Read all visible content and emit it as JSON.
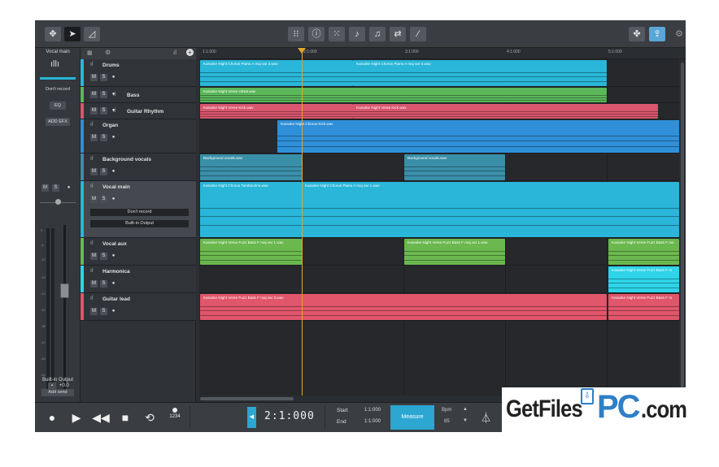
{
  "toolbar": {
    "left_icons": [
      "move-icon",
      "pointer-icon",
      "ramp-icon"
    ],
    "center_icons": [
      "grid-icon",
      "info-icon",
      "random-icon",
      "tuner-icon",
      "score-icon",
      "loop-icon",
      "wand-icon"
    ],
    "right_icons": [
      "settings-knob-icon",
      "share-icon",
      "gear-icon"
    ]
  },
  "inspector": {
    "title": "Vocal main",
    "record_mode": "Don't record",
    "eq_label": "EQ",
    "add_fx_label": "ADD EFX",
    "mute": "M",
    "solo": "S",
    "volume_value": "+0.0",
    "output": "Built-in Output",
    "add_send": "Add send",
    "meter_scale": [
      "0",
      "-6",
      "-12",
      "-18",
      "-24",
      "-30",
      "-36",
      "-42",
      "-48",
      "-54",
      "-60"
    ]
  },
  "header_controls": {
    "grid_icon": "track-grid-icon",
    "gear_icon": "gear-icon",
    "add_icon": "add-track-icon"
  },
  "tracks": [
    {
      "name": "Drums",
      "color": "#29b6d8",
      "m": "M",
      "s": "S"
    },
    {
      "name": "Bass",
      "color": "#5ab85a",
      "m": "M",
      "s": "S"
    },
    {
      "name": "Guitar Rhythm",
      "color": "#d9566e",
      "m": "M",
      "s": "S"
    },
    {
      "name": "Organ",
      "color": "#2f8fd8",
      "m": "M",
      "s": "S"
    },
    {
      "name": "Background vocals",
      "color": "#3a8fa8",
      "m": "M",
      "s": "S"
    },
    {
      "name": "Vocal main",
      "color": "#29b6d8",
      "m": "M",
      "s": "S",
      "record": "Don't record",
      "output": "Built-in Output"
    },
    {
      "name": "Vocal aux",
      "color": "#6ab84e",
      "m": "M",
      "s": "S"
    },
    {
      "name": "Harmonica",
      "color": "#2fd4e8",
      "m": "M",
      "s": "S"
    },
    {
      "name": "Guitar lead",
      "color": "#e0566a",
      "m": "M",
      "s": "S"
    }
  ],
  "ruler": [
    "1:1:000",
    "2:1:000",
    "3:1:000",
    "4:1:000",
    "5:1:000"
  ],
  "clips": {
    "drums": [
      "Karaoke Night Chorus Piano A maj var 3.wav",
      "Karaoke Night Chorus Piano A maj var 3.wav"
    ],
    "bass": [
      "Karaoke Night Verse HiHat.wav"
    ],
    "guitar_rhythm": [
      "Karaoke Night Verse Kick.wav",
      "Karaoke Night Verse Kick.wav"
    ],
    "organ": [
      "Karaoke Night Chorus Kick.wav"
    ],
    "background_vocals": [
      "Background vocals.wav",
      "Background vocals.wav"
    ],
    "vocal_main": [
      "Karaoke Night Chorus Tambourine.wav",
      "Karaoke Night Chorus Piano A maj var 1.wav"
    ],
    "vocal_aux": [
      "Karaoke Night Verse Fuzz Bass F maj var 1.wav",
      "Karaoke Night Verse Fuzz Bass F maj var 1.wav",
      "Karaoke Night Verse Fuzz Bass F ma"
    ],
    "harmonica": [
      "Karaoke Night Verse Fuzz Bass F m"
    ],
    "guitar_lead": [
      "Karaoke Night Verse Fuzz Bass F maj var 3.wav",
      "Karaoke Night Verse Fuzz Bass F m"
    ]
  },
  "transport": {
    "time": "2:1:000",
    "start_label": "Start",
    "start_value": "1:1:000",
    "end_label": "End",
    "end_value": "1:1:000",
    "measure_label": "Measure",
    "bpm_label": "Bpm",
    "bpm_value": "85",
    "count_in": "1234"
  },
  "watermark": {
    "a": "GetFiles",
    "b": "PC",
    "c": ".com"
  }
}
